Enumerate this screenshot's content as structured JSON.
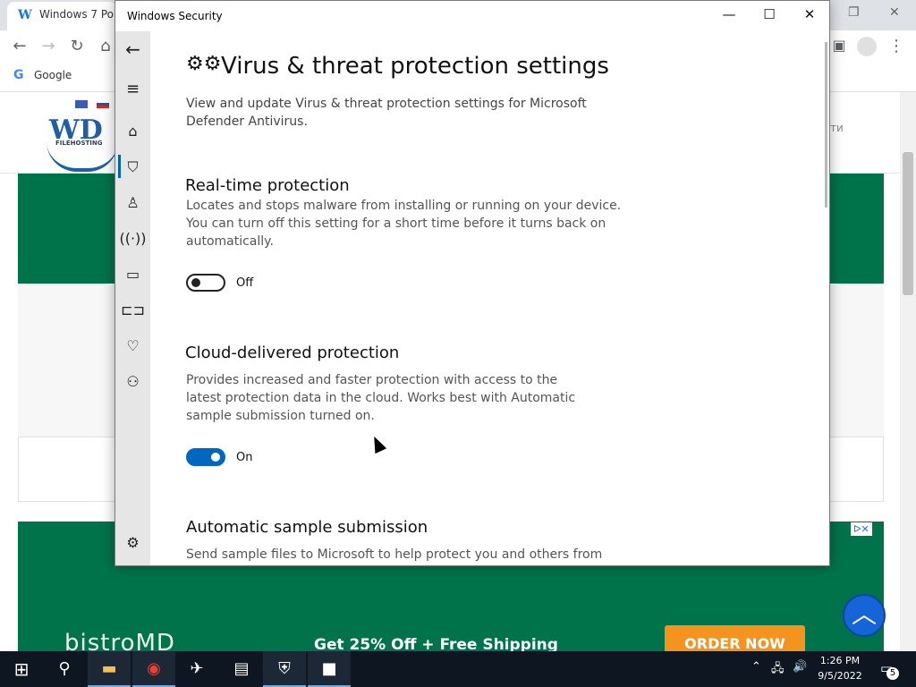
{
  "browser": {
    "tab_title": "Windows 7 Pon",
    "tab_favicon": "W",
    "bookmark_google": "Google",
    "bookmark_google_icon": "G",
    "site_logo": "WD",
    "site_logo_sub": "FILEHOSTING",
    "header_right_text": "ти",
    "ad_badge": "ᐅ✕",
    "ad_logo": "bistroMD",
    "ad_offer": "Get 25% Off + Free Shipping",
    "ad_button": "ORDER NOW"
  },
  "security": {
    "window_title": "Windows Security",
    "heading": "Virus & threat protection settings",
    "heading_icon": "gears-icon",
    "description": "View and update Virus & threat protection settings for Microsoft Defender Antivirus.",
    "sections": [
      {
        "title": "Real-time protection",
        "text": "Locates and stops malware from installing or running on your device. You can turn off this setting for a short time before it turns back on automatically.",
        "toggle_state": "Off"
      },
      {
        "title": "Cloud-delivered protection",
        "text": "Provides increased and faster protection with access to the latest protection data in the cloud. Works best with Automatic sample submission turned on.",
        "toggle_state": "On"
      },
      {
        "title": "Automatic sample submission",
        "text": "Send sample files to Microsoft to help protect you and others from"
      }
    ],
    "nav_icons": [
      "back-icon",
      "menu-icon",
      "home-icon",
      "shield-icon",
      "account-icon",
      "firewall-icon",
      "app-browser-icon",
      "device-security-icon",
      "health-icon",
      "family-icon",
      "settings-icon"
    ]
  },
  "taskbar": {
    "time": "1:26 PM",
    "date": "9/5/2022",
    "notification_count": "5"
  }
}
